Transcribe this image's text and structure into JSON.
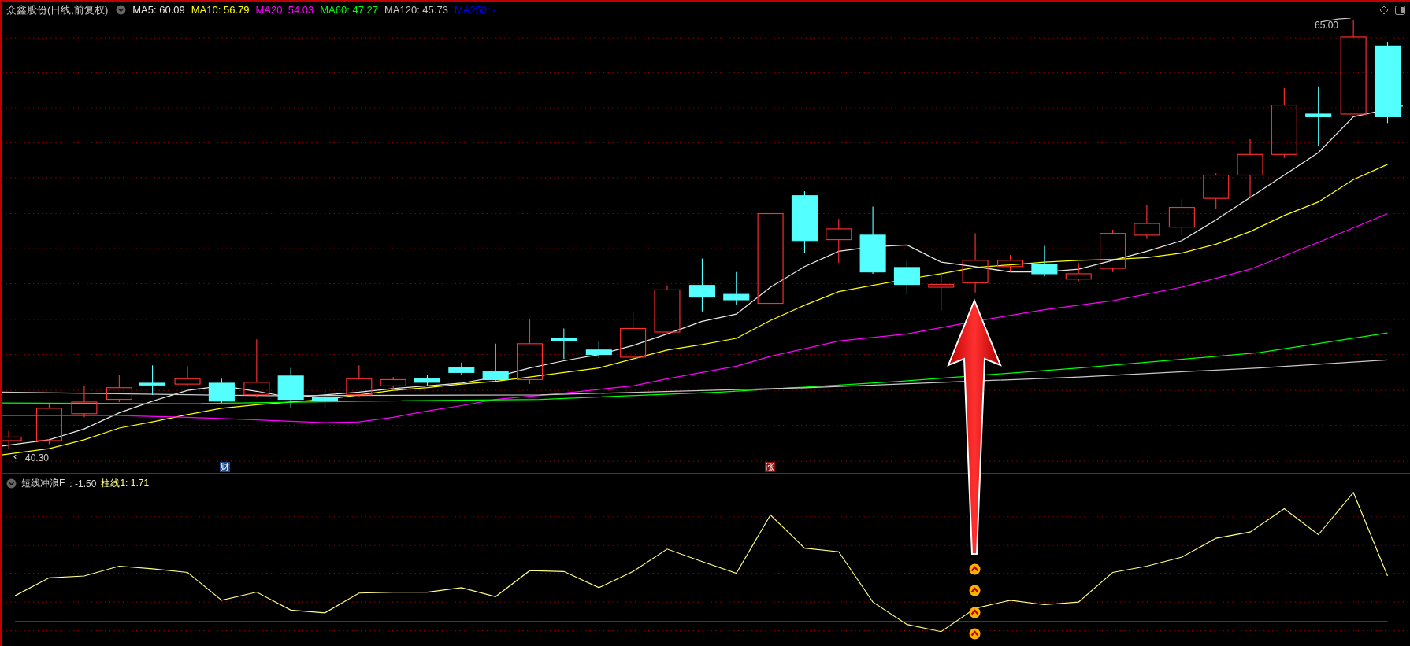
{
  "chart_header": {
    "title": "众鑫股份(日线,前复权)",
    "indicators": [
      {
        "label": "MA5: 60.09",
        "color": "#e8e8e8"
      },
      {
        "label": "MA10: 56.79",
        "color": "#ffff00"
      },
      {
        "label": "MA20: 54.03",
        "color": "#ff00ff"
      },
      {
        "label": "MA60: 47.27",
        "color": "#00ff00"
      },
      {
        "label": "MA120: 45.73",
        "color": "#c8c8c8"
      },
      {
        "label": "MA250: -",
        "color": "#0000ff"
      }
    ]
  },
  "main_chart": {
    "high_label": "65.00",
    "low_label": "40.30",
    "markers": [
      {
        "text": "财",
        "kind": "finance"
      },
      {
        "text": "涨",
        "kind": "limit_up"
      }
    ]
  },
  "sub_chart": {
    "name": "短线冲浪F",
    "value": ": -1.50",
    "bar_label": "柱线1: 1.71"
  }
}
